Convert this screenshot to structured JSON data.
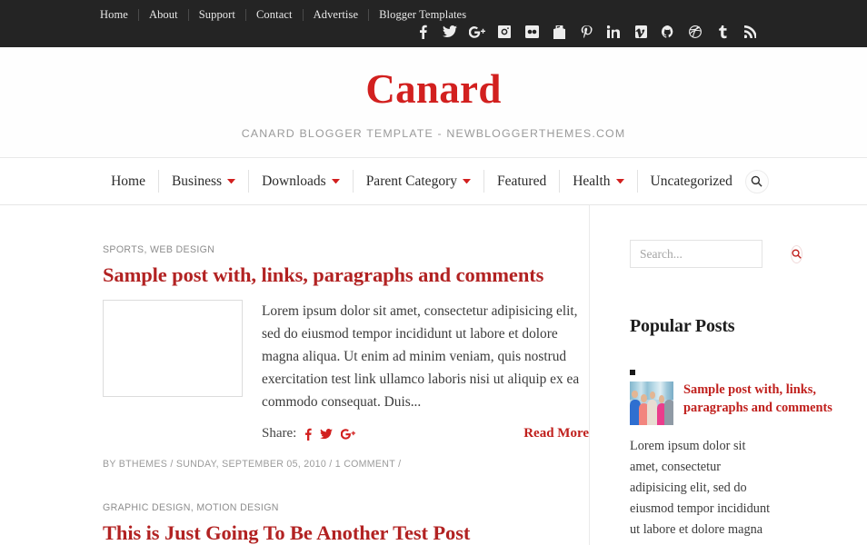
{
  "topbar": {
    "nav": [
      {
        "label": "Home"
      },
      {
        "label": "About"
      },
      {
        "label": "Support"
      },
      {
        "label": "Contact"
      },
      {
        "label": "Advertise"
      },
      {
        "label": "Blogger Templates"
      }
    ],
    "social": [
      {
        "name": "facebook-icon"
      },
      {
        "name": "twitter-icon"
      },
      {
        "name": "google-plus-icon"
      },
      {
        "name": "instagram-icon"
      },
      {
        "name": "flickr-icon"
      },
      {
        "name": "youtube-icon"
      },
      {
        "name": "pinterest-icon"
      },
      {
        "name": "linkedin-icon"
      },
      {
        "name": "vimeo-icon"
      },
      {
        "name": "github-icon"
      },
      {
        "name": "dribbble-icon"
      },
      {
        "name": "tumblr-icon"
      },
      {
        "name": "rss-icon"
      }
    ]
  },
  "header": {
    "title": "Canard",
    "tagline": "CANARD BLOGGER TEMPLATE - NEWBLOGGERTHEMES.COM"
  },
  "menu": {
    "items": [
      {
        "label": "Home",
        "has_dropdown": false
      },
      {
        "label": "Business",
        "has_dropdown": true
      },
      {
        "label": "Downloads",
        "has_dropdown": true
      },
      {
        "label": "Parent Category",
        "has_dropdown": true
      },
      {
        "label": "Featured",
        "has_dropdown": false
      },
      {
        "label": "Health",
        "has_dropdown": true
      },
      {
        "label": "Uncategorized",
        "has_dropdown": false
      }
    ],
    "search_icon": "search-icon"
  },
  "posts": [
    {
      "categories": "SPORTS, WEB DESIGN",
      "title": "Sample post with, links, paragraphs and comments",
      "excerpt": "Lorem ipsum dolor sit amet, consectetur adipisicing elit, sed do eiusmod tempor incididunt ut labore et dolore magna aliqua. Ut enim ad minim veniam, quis nostrud exercitation test link ullamco laboris nisi ut aliquip ex ea commodo consequat. Duis...",
      "share_label": "Share:",
      "share_icons": [
        "facebook-icon",
        "twitter-icon",
        "google-plus-icon"
      ],
      "read_more": "Read More",
      "byline": "BY BTHEMES / SUNDAY, SEPTEMBER 05, 2010 /  1 COMMENT  /"
    },
    {
      "categories": "GRAPHIC DESIGN, MOTION DESIGN",
      "title": "This is Just Going To Be Another Test Post"
    }
  ],
  "sidebar": {
    "search": {
      "placeholder": "Search...",
      "value": "",
      "button_icon": "search-icon"
    },
    "popular_posts": {
      "heading": "Popular Posts",
      "items": [
        {
          "title": "Sample post with, links, paragraphs and comments",
          "excerpt": "Lorem ipsum dolor sit amet, consectetur adipisicing elit, sed do eiusmod tempor incididunt ut labore et dolore magna"
        }
      ]
    }
  },
  "colors": {
    "brand_red": "#d2201f",
    "title_red": "#b22222",
    "topbar_bg": "#242424",
    "muted_text": "#9a9a9a"
  }
}
